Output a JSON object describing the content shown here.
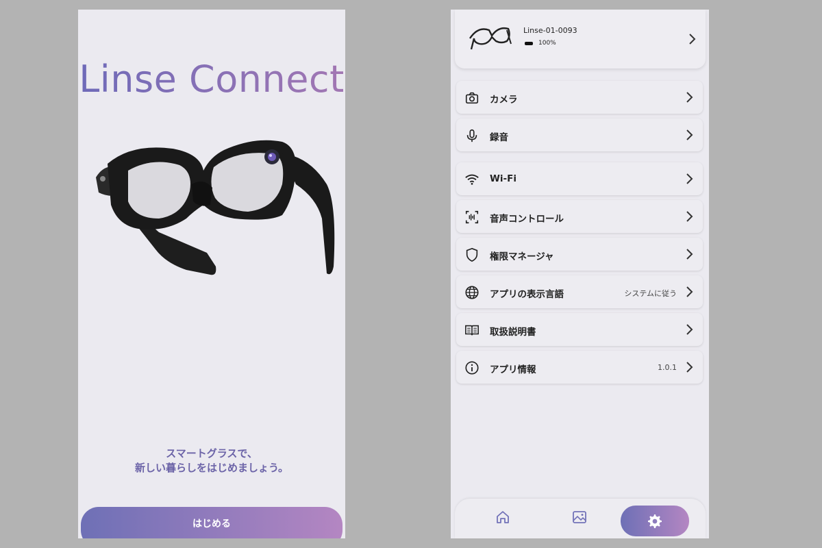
{
  "welcome": {
    "title": "Linse Connect",
    "tagline_line1": "スマートグラスで、",
    "tagline_line2": "新しい暮らしをはじめましょう。",
    "start_button": "はじめる"
  },
  "settings": {
    "device": {
      "name": "Linse-01-0093",
      "battery": "100%"
    },
    "groups": [
      [
        {
          "label": "カメラ",
          "icon": "camera-icon"
        },
        {
          "label": "録音",
          "icon": "microphone-icon"
        }
      ],
      [
        {
          "label": "Wi-Fi",
          "icon": "wifi-icon"
        },
        {
          "label": "音声コントロール",
          "icon": "voice-control-icon"
        },
        {
          "label": "権限マネージャ",
          "icon": "shield-icon"
        },
        {
          "label": "アプリの表示言語",
          "icon": "globe-icon",
          "value": "システムに従う"
        },
        {
          "label": "取扱説明書",
          "icon": "book-icon"
        },
        {
          "label": "アプリ情報",
          "icon": "info-icon",
          "value": "1.0.1"
        }
      ]
    ],
    "tabs": [
      "home-icon",
      "gallery-icon",
      "gear-icon"
    ]
  },
  "colors": {
    "accent_start": "#6e70b6",
    "accent_end": "#b486c2",
    "background": "#ebeaf0"
  }
}
